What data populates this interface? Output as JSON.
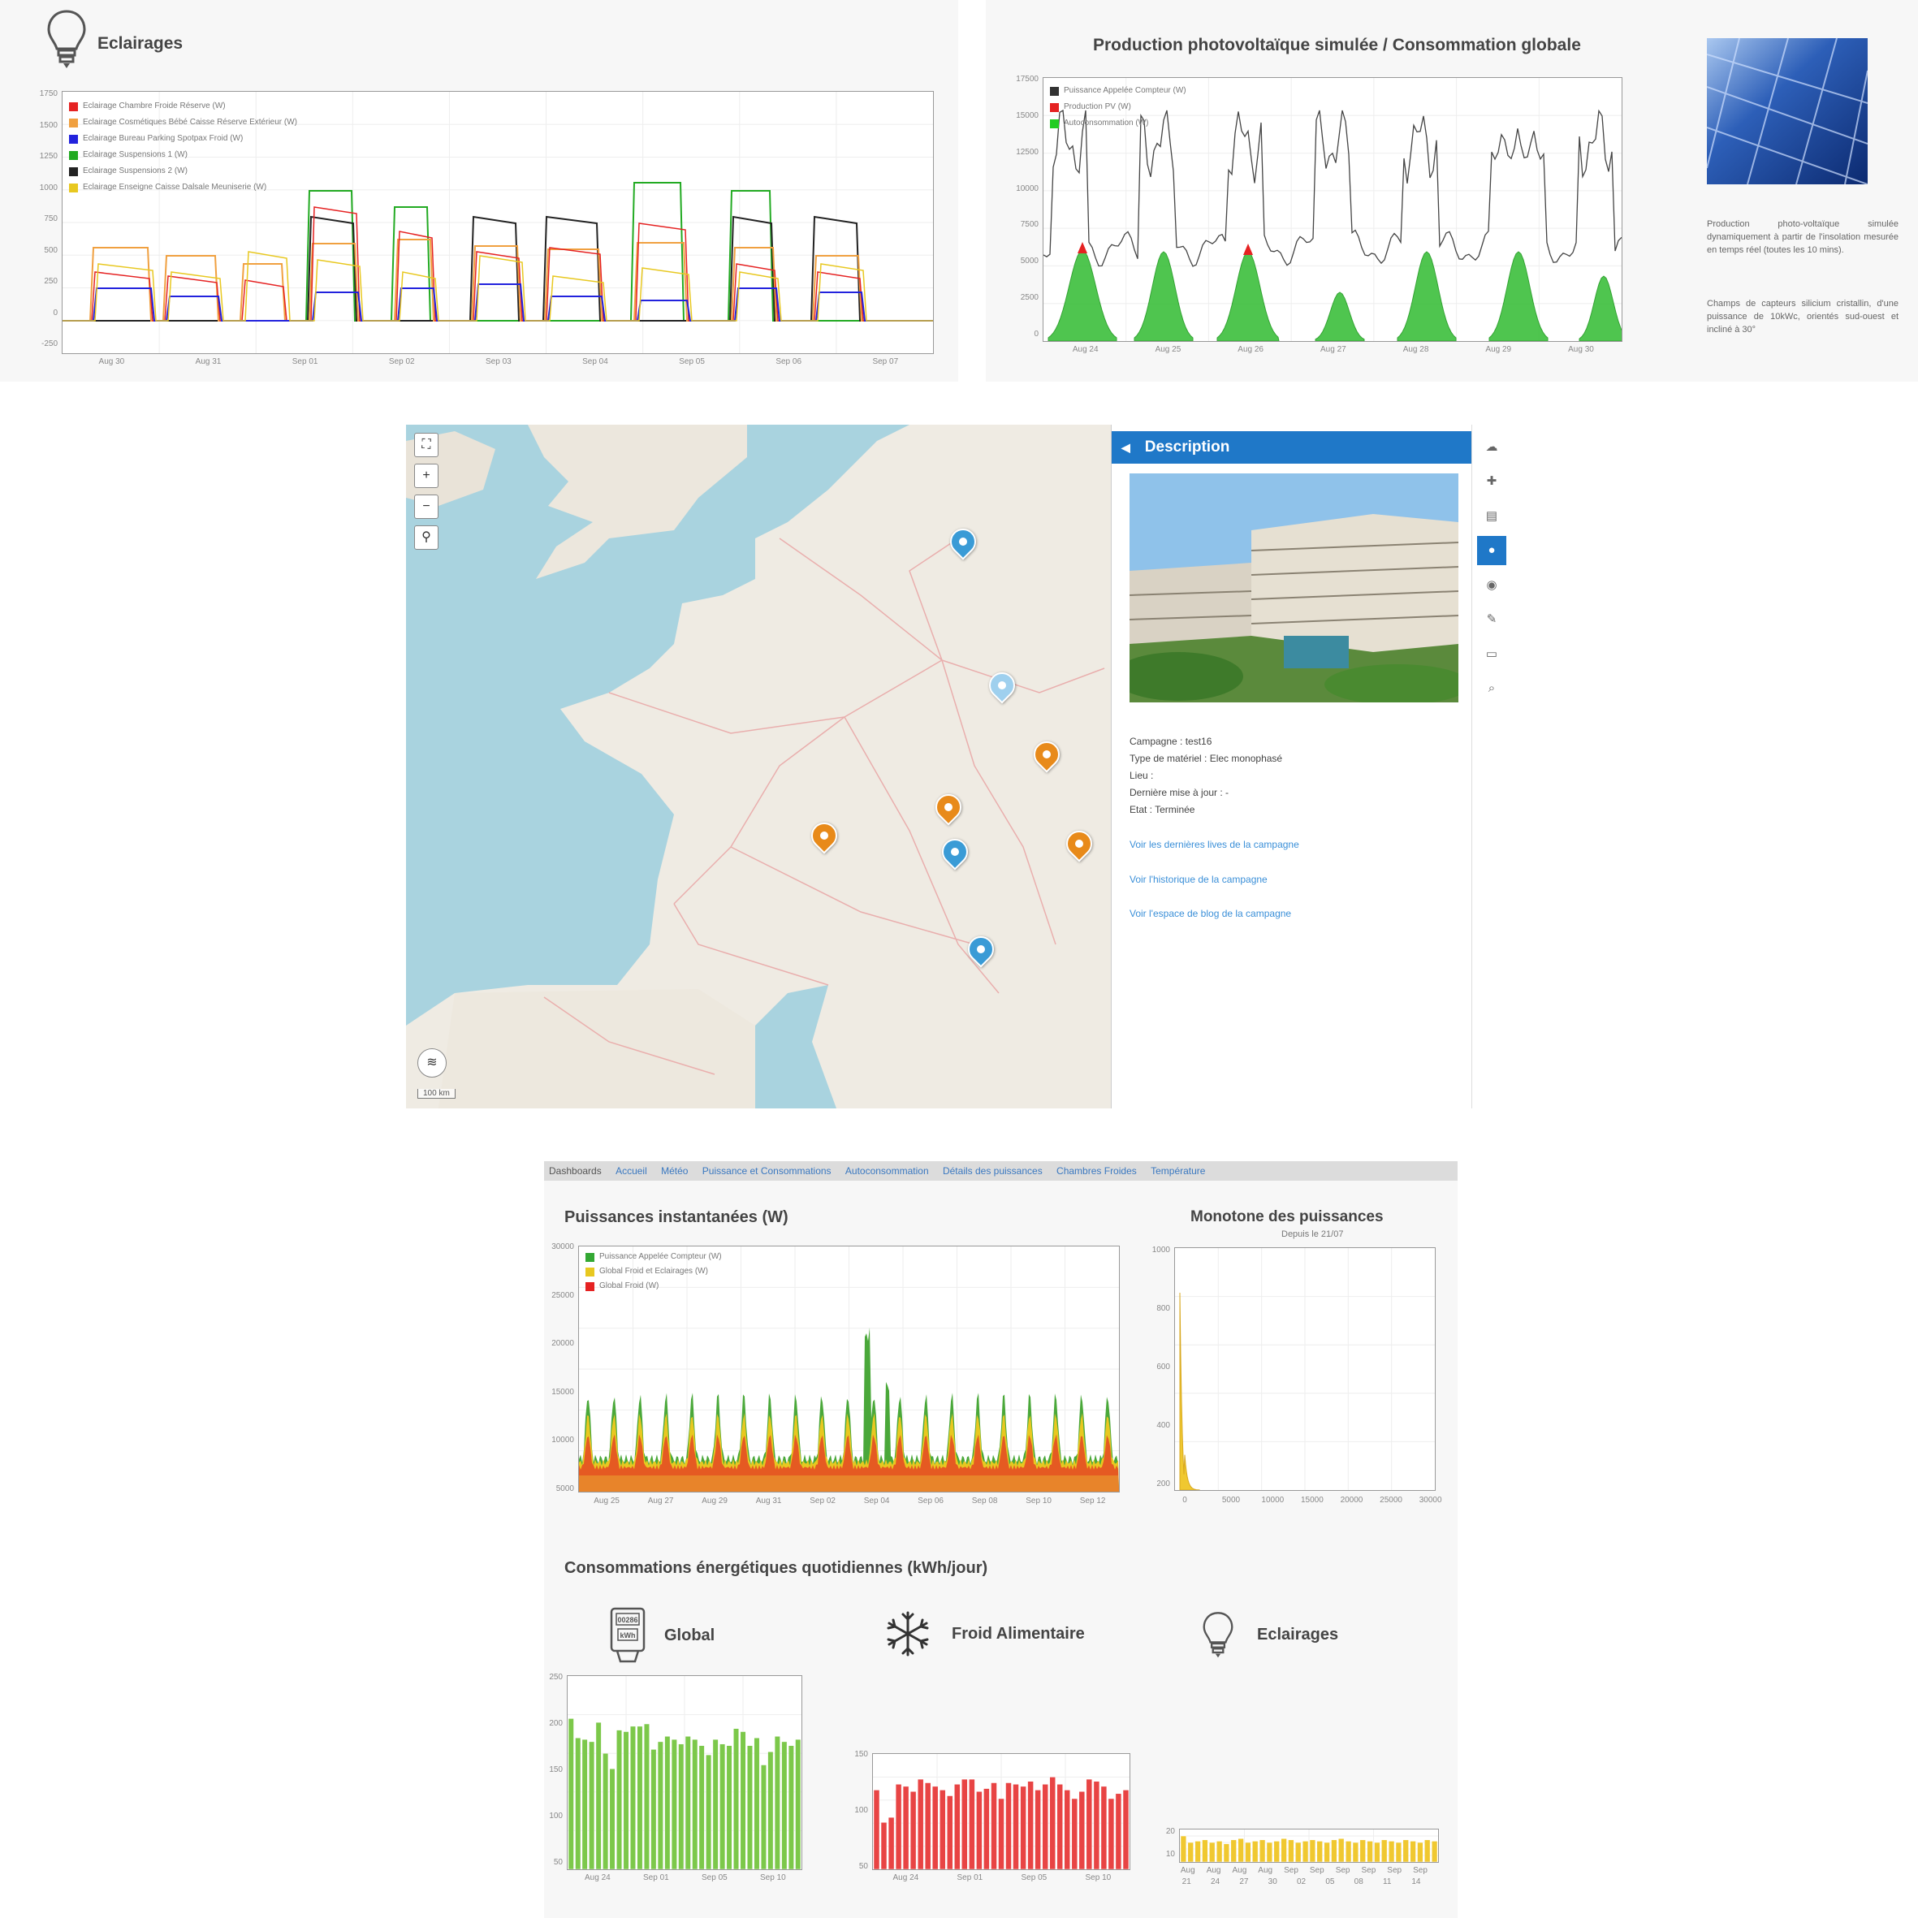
{
  "lighting_panel": {
    "title": "Eclairages",
    "icon": "lightbulb-icon",
    "legend": [
      {
        "label": "Eclairage Chambre Froide Réserve (W)",
        "color": "#e52222"
      },
      {
        "label": "Eclairage Cosmétiques Bébé Caisse Réserve Extérieur (W)",
        "color": "#f0a040"
      },
      {
        "label": "Eclairage Bureau Parking Spotpax Froid (W)",
        "color": "#2222dd"
      },
      {
        "label": "Eclairage Suspensions 1 (W)",
        "color": "#22aa22"
      },
      {
        "label": "Eclairage Suspensions 2 (W)",
        "color": "#222222"
      },
      {
        "label": "Eclairage Enseigne Caisse Dalsale Meuniserie (W)",
        "color": "#e8c820"
      }
    ],
    "y_ticks": [
      "1750",
      "1500",
      "1250",
      "1000",
      "750",
      "500",
      "250",
      "0",
      "-250"
    ],
    "x_ticks": [
      "Aug 30",
      "Aug 31",
      "Sep 01",
      "Sep 02",
      "Sep 03",
      "Sep 04",
      "Sep 05",
      "Sep 06",
      "Sep 07"
    ]
  },
  "pv_panel": {
    "title": "Production photovoltaïque simulée / Consommation globale",
    "legend": [
      {
        "label": "Puissance Appelée Compteur (W)",
        "color": "#333333"
      },
      {
        "label": "Production PV (W)",
        "color": "#e52222"
      },
      {
        "label": "Autoconsommation (W)",
        "color": "#22cc22"
      }
    ],
    "y_ticks": [
      "17500",
      "15000",
      "12500",
      "10000",
      "7500",
      "5000",
      "2500",
      "0"
    ],
    "x_ticks": [
      "Aug 24",
      "Aug 25",
      "Aug 26",
      "Aug 27",
      "Aug 28",
      "Aug 29",
      "Aug 30"
    ],
    "description_1": "Production photo-voltaïque simulée dynamiquement à partir de l'insolation mesurée en temps réel (toutes les 10 mins).",
    "description_2": "Champs de capteurs silicium cristallin, d'une puissance de 10kWc, orientés sud-ouest et incliné à 30°"
  },
  "map_panel": {
    "controls": [
      {
        "name": "fullscreen-button",
        "label": "⛶"
      },
      {
        "name": "zoom-in-button",
        "label": "+"
      },
      {
        "name": "zoom-out-button",
        "label": "−"
      },
      {
        "name": "locate-button",
        "label": "⚲"
      }
    ],
    "scale_label": "100 km",
    "markers": [
      {
        "color": "blue"
      },
      {
        "color": "light"
      },
      {
        "color": "orange"
      },
      {
        "color": "orange"
      },
      {
        "color": "orange"
      },
      {
        "color": "blue"
      },
      {
        "color": "orange"
      },
      {
        "color": "blue"
      }
    ],
    "sidebar": {
      "header": "Description",
      "campaign_line": "Campagne : test16",
      "material_line": "Type de matériel : Elec monophasé",
      "place_line": "Lieu :",
      "update_line": "Dernière mise à jour : -",
      "state_line": "Etat : Terminée",
      "links": [
        "Voir les dernières lives de la campagne",
        "Voir l'historique de la campagne",
        "Voir l'espace de blog de la campagne"
      ]
    },
    "tools": [
      "☁",
      "✚",
      "▤",
      "●",
      "◉",
      "✎",
      "▭",
      "⌕"
    ]
  },
  "dashboard": {
    "nav": [
      "Dashboards",
      "Accueil",
      "Météo",
      "Puissance et Consommations",
      "Autoconsommation",
      "Détails des puissances",
      "Chambres Froides",
      "Température"
    ],
    "instant_title": "Puissances instantanées (W)",
    "instant_legend": [
      {
        "label": "Puissance Appelée Compteur (W)",
        "color": "#33a833"
      },
      {
        "label": "Global Froid et Eclairages (W)",
        "color": "#e8c820"
      },
      {
        "label": "Global Froid (W)",
        "color": "#e52222"
      }
    ],
    "instant_y_ticks": [
      "30000",
      "25000",
      "20000",
      "15000",
      "10000",
      "5000"
    ],
    "instant_x_ticks": [
      "Aug 25",
      "Aug 27",
      "Aug 29",
      "Aug 31",
      "Sep 02",
      "Sep 04",
      "Sep 06",
      "Sep 08",
      "Sep 10",
      "Sep 12"
    ],
    "monotone_title": "Monotone des puissances",
    "monotone_subtitle": "Depuis le 21/07",
    "monotone_y_ticks": [
      "1000",
      "800",
      "600",
      "400",
      "200"
    ],
    "monotone_x_ticks": [
      "0",
      "5000",
      "10000",
      "15000",
      "20000",
      "25000",
      "30000"
    ],
    "daily_title": "Consommations énergétiques quotidiennes (kWh/jour)",
    "categories": [
      {
        "label": "Global",
        "icon": "meter-icon",
        "meter_text_1": "00286",
        "meter_text_2": "kWh"
      },
      {
        "label": "Froid Alimentaire",
        "icon": "snowflake-icon"
      },
      {
        "label": "Eclairages",
        "icon": "lightbulb-icon"
      }
    ],
    "global_y_ticks": [
      "250",
      "200",
      "150",
      "100",
      "50"
    ],
    "global_x_ticks": [
      "Aug 24",
      "Sep 01",
      "Sep 05",
      "Sep 10"
    ],
    "froid_y_ticks": [
      "150",
      "100",
      "50"
    ],
    "froid_x_ticks": [
      "Aug 24",
      "Sep 01",
      "Sep 05",
      "Sep 10"
    ],
    "ecl_y_ticks": [
      "20",
      "10"
    ],
    "ecl_x_ticks": [
      "Aug",
      "Aug",
      "Aug",
      "Aug",
      "Sep",
      "Sep",
      "Sep",
      "Sep",
      "Sep",
      "Sep"
    ],
    "ecl_x_ticks_2": [
      "21",
      "24",
      "27",
      "30",
      "02",
      "05",
      "08",
      "11",
      "14"
    ],
    "global_color": "#7cc84a",
    "froid_color": "#e84444",
    "ecl_color": "#f0c830",
    "global_values": [
      195,
      170,
      168,
      165,
      190,
      150,
      130,
      180,
      178,
      185,
      185,
      188,
      155,
      165,
      172,
      168,
      162,
      172,
      168,
      160,
      148,
      168,
      162,
      160,
      182,
      178,
      160,
      170,
      135,
      152,
      172,
      165,
      160,
      168
    ],
    "froid_values": [
      110,
      65,
      72,
      118,
      115,
      108,
      125,
      120,
      115,
      110,
      102,
      118,
      125,
      125,
      108,
      112,
      120,
      98,
      120,
      118,
      115,
      122,
      110,
      118,
      128,
      118,
      110,
      98,
      108,
      125,
      122,
      115,
      98,
      105,
      110
    ],
    "ecl_values": [
      20,
      15,
      16,
      17,
      15,
      16,
      14,
      17,
      18,
      15,
      16,
      17,
      15,
      16,
      18,
      17,
      15,
      16,
      17,
      16,
      15,
      17,
      18,
      16,
      15,
      17,
      16,
      15,
      17,
      16,
      15,
      17,
      16,
      15,
      17,
      16
    ]
  }
}
